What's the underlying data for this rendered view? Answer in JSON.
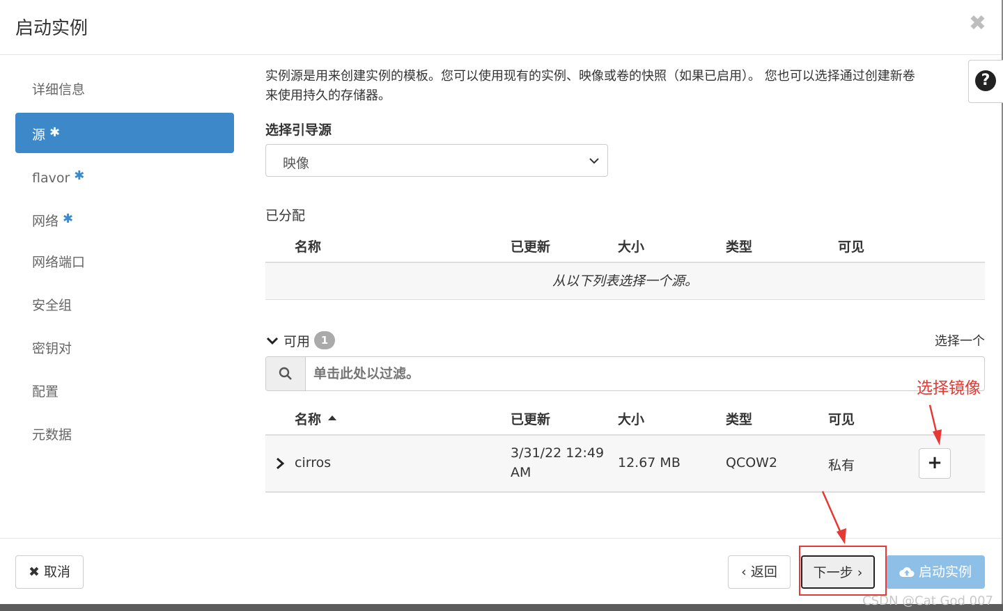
{
  "modal": {
    "title": "启动实例",
    "close_icon": "close-icon"
  },
  "sidebar": {
    "items": [
      {
        "label": "详细信息",
        "required": false,
        "active": false
      },
      {
        "label": "源",
        "required": true,
        "active": true
      },
      {
        "label": "flavor",
        "required": true,
        "active": false
      },
      {
        "label": "网络",
        "required": true,
        "active": false
      },
      {
        "label": "网络端口",
        "required": false,
        "active": false
      },
      {
        "label": "安全组",
        "required": false,
        "active": false
      },
      {
        "label": "密钥对",
        "required": false,
        "active": false
      },
      {
        "label": "配置",
        "required": false,
        "active": false
      },
      {
        "label": "元数据",
        "required": false,
        "active": false
      }
    ],
    "required_mark": "✱"
  },
  "help": {
    "icon": "question-circle-icon",
    "glyph": "?"
  },
  "source": {
    "description_line1": "实例源是用来创建实例的模板。您可以使用现有的实例、映像或卷的快照（如果已启用）。 您也可以选择通过创建新卷",
    "description_line2": "来使用持久的存储器。",
    "boot_source_label": "选择引导源",
    "boot_source_value": "映像"
  },
  "allocated": {
    "label": "已分配",
    "columns": [
      "名称",
      "已更新",
      "大小",
      "类型",
      "可见"
    ],
    "empty_message": "从以下列表选择一个源。"
  },
  "available": {
    "label": "可用",
    "count": "1",
    "select_one": "选择一个",
    "filter_placeholder": "单击此处以过滤。",
    "columns": [
      "名称",
      "已更新",
      "大小",
      "类型",
      "可见"
    ],
    "rows": [
      {
        "name": "cirros",
        "updated_line1": "3/31/22 12:49",
        "updated_line2": "AM",
        "size": "12.67 MB",
        "type": "QCOW2",
        "visibility": "私有"
      }
    ]
  },
  "annotation": {
    "text": "选择镜像",
    "color": "#e53935"
  },
  "footer": {
    "cancel": "取消",
    "back": "返回",
    "next": "下一步",
    "launch": "启动实例"
  },
  "watermark": "CSDN @Cat God 007",
  "colors": {
    "accent": "#3c88c9",
    "launch_disabled": "#8ebfe6",
    "annotation": "#e53935"
  }
}
